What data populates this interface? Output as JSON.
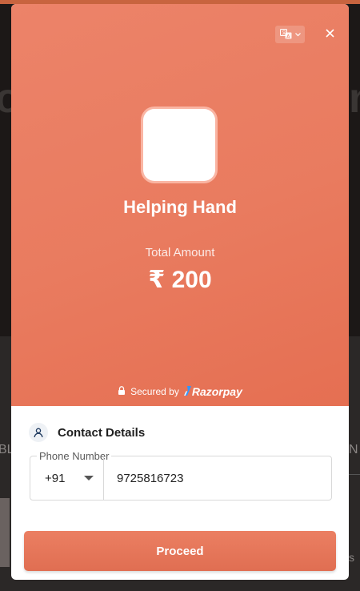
{
  "background": {
    "hero_fragment_left": "o",
    "hero_fragment_right": "n",
    "side_fragment_left": "BL",
    "side_fragment_right": "N",
    "side_fragment_right_2": "s"
  },
  "checkout": {
    "merchant_name": "Helping Hand",
    "amount_label": "Total Amount",
    "amount_value": "₹ 200",
    "secured_by": "Secured by",
    "brand_name": "Razorpay",
    "brand_color": "#3395ff",
    "theme_color": "#e97b5f",
    "icons": {
      "language": "translate-icon",
      "close": "close-icon",
      "lock": "lock-icon",
      "user": "user-icon"
    }
  },
  "contact": {
    "title": "Contact Details",
    "phone_label": "Phone Number",
    "country_code": "+91",
    "phone_value": "9725816723",
    "proceed_label": "Proceed"
  }
}
